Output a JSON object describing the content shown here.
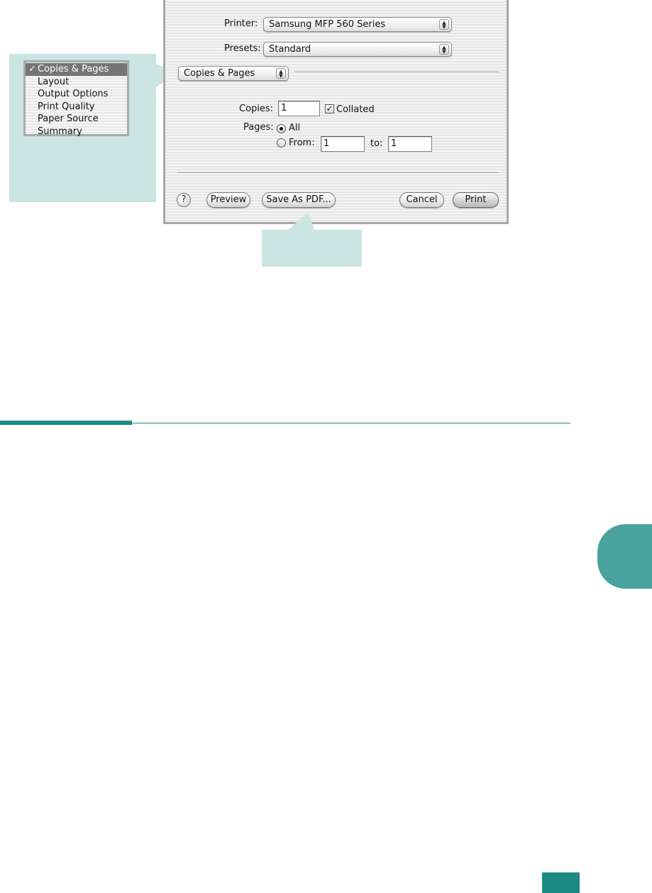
{
  "dialog": {
    "printer_label": "Printer:",
    "printer_value": "Samsung MFP 560 Series",
    "presets_label": "Presets:",
    "presets_value": "Standard",
    "panel_value": "Copies & Pages",
    "copies_label": "Copies:",
    "copies_value": "1",
    "collated_label": "Collated",
    "collated_checked": true,
    "pages_label": "Pages:",
    "pages_all_label": "All",
    "pages_from_label": "From:",
    "pages_from_value": "1",
    "pages_to_label": "to:",
    "pages_to_value": "1",
    "help_glyph": "?",
    "buttons": {
      "preview": "Preview",
      "save_pdf": "Save As PDF...",
      "cancel": "Cancel",
      "print": "Print"
    }
  },
  "panel_menu": {
    "check_glyph": "✓",
    "items": [
      "Copies & Pages",
      "Layout",
      "Output Options",
      "Print Quality",
      "Paper Source",
      "Summary"
    ],
    "selected_index": 0
  },
  "colors": {
    "accent": "#1c8a83",
    "callout": "#cbe5e3",
    "tab": "#4aa29e"
  },
  "icons": {
    "help": "help-icon",
    "popup_arrows": "up-down-arrows-icon",
    "check": "checkmark-icon"
  }
}
